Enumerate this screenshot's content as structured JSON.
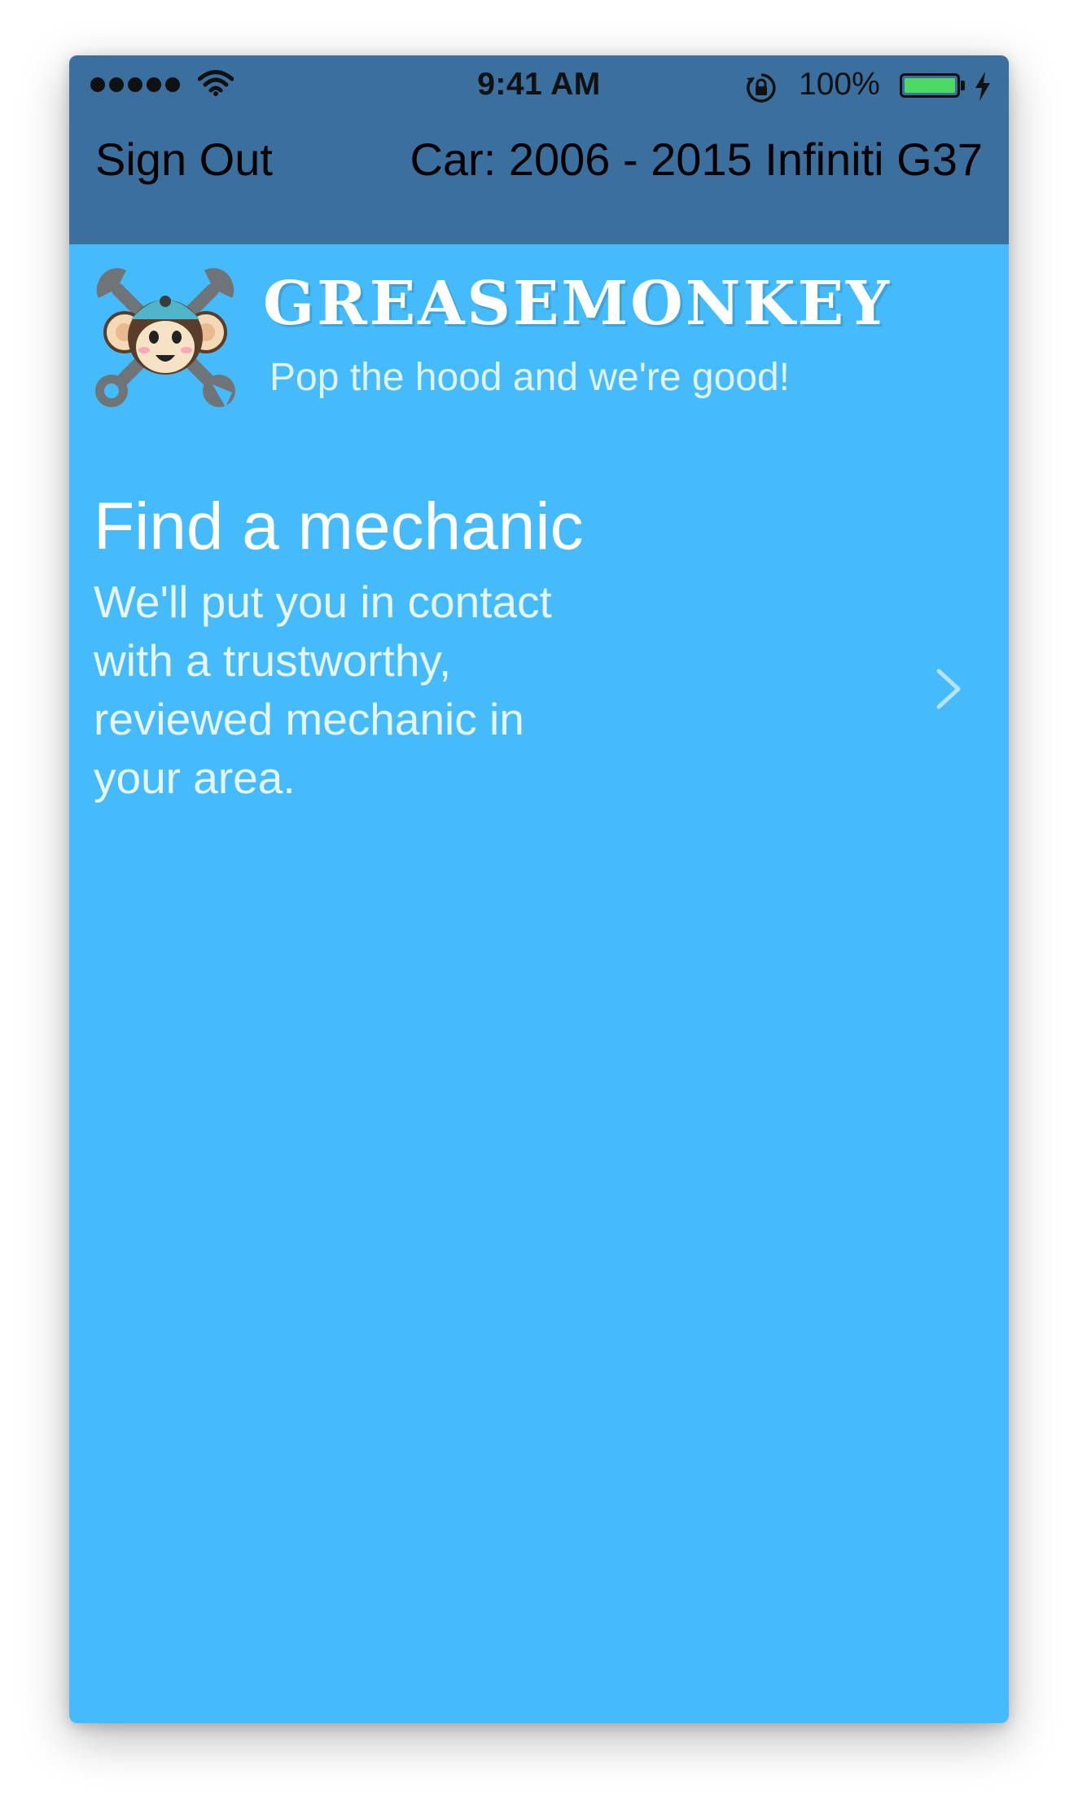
{
  "status_bar": {
    "time": "9:41 AM",
    "battery_percent": "100%",
    "signal_bars": 5,
    "battery_color": "#4cd964",
    "icons": [
      "signal-dots-icon",
      "wifi-icon",
      "rotation-lock-icon",
      "battery-icon",
      "charging-bolt-icon"
    ]
  },
  "nav": {
    "sign_out_label": "Sign Out",
    "car_label": "Car: 2006 - 2015 Infiniti G37"
  },
  "brand": {
    "name": "GREASEMONKEY",
    "tagline": "Pop the hood and we're good!",
    "logo_icon": "monkey-wrench-logo-icon"
  },
  "card": {
    "title": "Find a mechanic",
    "description": "We'll put you in contact with a trustworthy, reviewed mechanic in your area.",
    "chevron_icon": "chevron-right-icon"
  },
  "colors": {
    "background": "#45bbfb",
    "navbar": "#3a6f9e",
    "text": "#ffffff"
  }
}
